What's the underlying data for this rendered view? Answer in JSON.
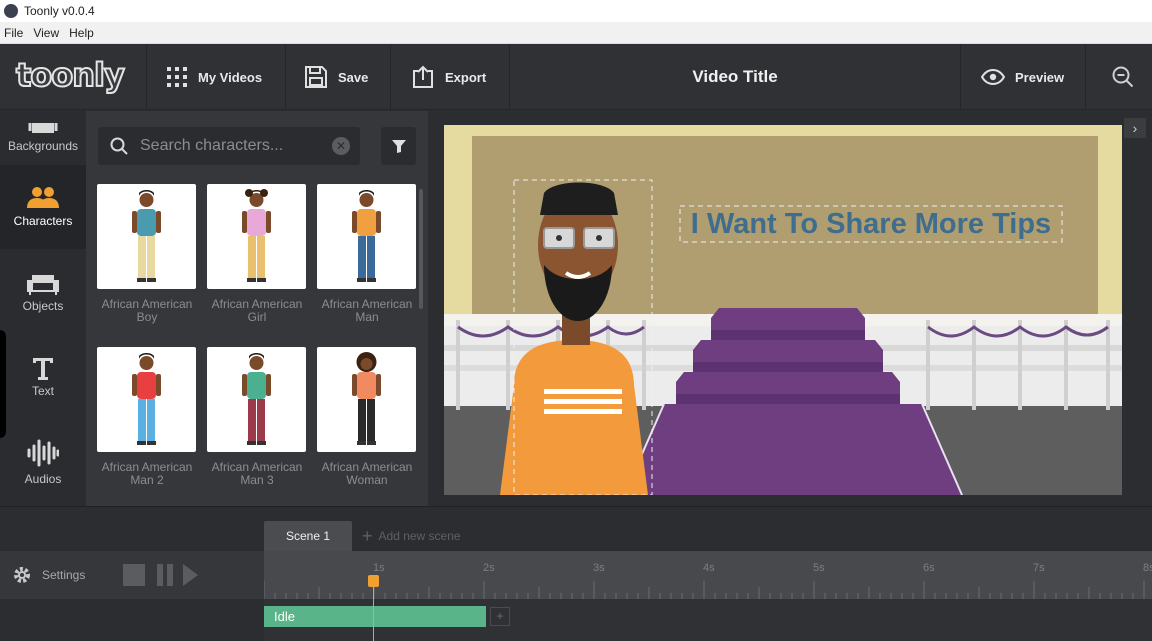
{
  "window": {
    "title": "Toonly v0.0.4"
  },
  "menu": [
    "File",
    "View",
    "Help"
  ],
  "header": {
    "logo": "toonly",
    "my_videos": "My Videos",
    "save": "Save",
    "export": "Export",
    "video_title": "Video Title",
    "preview": "Preview"
  },
  "nav": {
    "backgrounds": "Backgrounds",
    "characters": "Characters",
    "objects": "Objects",
    "text": "Text",
    "audios": "Audios"
  },
  "search": {
    "placeholder": "Search characters..."
  },
  "characters": [
    {
      "line1": "African American",
      "line2": "Boy",
      "shirt": "#4a9bb0",
      "pants": "#e8d9a0"
    },
    {
      "line1": "African American",
      "line2": "Girl",
      "shirt": "#e8a8d8",
      "pants": "#e8c070"
    },
    {
      "line1": "African American",
      "line2": "Man",
      "shirt": "#f0a040",
      "pants": "#3a6a9a"
    },
    {
      "line1": "African American",
      "line2": "Man 2",
      "shirt": "#e84040",
      "pants": "#5ab0e0"
    },
    {
      "line1": "African American",
      "line2": "Man 3",
      "shirt": "#4ab090",
      "pants": "#9a3a4a"
    },
    {
      "line1": "African American",
      "line2": "Woman",
      "shirt": "#f08a60",
      "pants": "#2a2a2a"
    }
  ],
  "stage": {
    "text": "I Want To Share More Tips"
  },
  "timeline": {
    "scene_tab": "Scene 1",
    "add_scene": "Add new scene",
    "settings": "Settings",
    "ticks": [
      "1s",
      "2s",
      "3s",
      "4s",
      "5s",
      "6s",
      "7s",
      "8s"
    ],
    "idle": "Idle",
    "plus": "+"
  },
  "colors": {
    "accent_green": "#5ab48a",
    "playhead": "#f0a030"
  }
}
